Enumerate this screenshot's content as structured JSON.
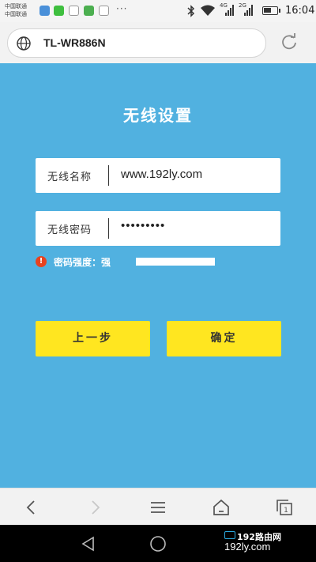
{
  "status_bar": {
    "carrier_lines": [
      "中国联通",
      "中国联通"
    ],
    "notification_icons": [
      "phone-manager-icon",
      "wechat-icon",
      "qq-icon",
      "sms-icon",
      "gallery-icon"
    ],
    "more": "···",
    "network_1": "4G",
    "network_2": "2G",
    "time": "16:04"
  },
  "browser": {
    "url": "TL-WR886N"
  },
  "page": {
    "title": "无线设置",
    "ssid_label": "无线名称",
    "ssid_value": "www.192ly.com",
    "password_label": "无线密码",
    "password_value": "•••••••••",
    "strength_label": "密码强度：强",
    "strength_level": 1.0,
    "warning_glyph": "!",
    "prev_button": "上一步",
    "ok_button": "确定"
  },
  "watermark": {
    "top": "192路由网",
    "bottom": "192ly.com"
  },
  "colors": {
    "background": "#51b1e0",
    "button": "#ffe620",
    "warning": "#e8421f",
    "field": "#ffffff"
  }
}
